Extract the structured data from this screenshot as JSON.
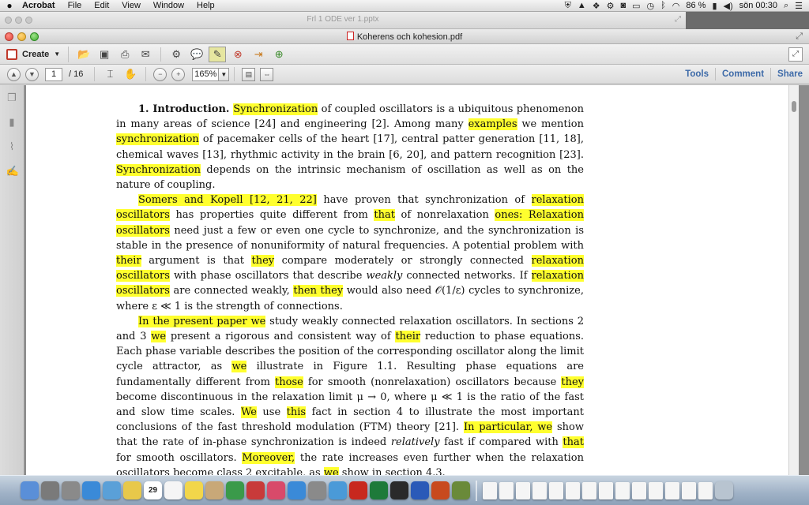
{
  "menubar": {
    "apple": "",
    "items": [
      "Acrobat",
      "File",
      "Edit",
      "View",
      "Window",
      "Help"
    ],
    "battery": "86 %",
    "clock": "sön 00:30"
  },
  "background_window": {
    "title": "Frl 1 ODE ver 1.pptx"
  },
  "window": {
    "title": "Koherens och kohesion.pdf"
  },
  "toolbar": {
    "create_label": "Create"
  },
  "navigation": {
    "current_page": "1",
    "total_pages": "/ 16",
    "zoom": "165%"
  },
  "panels": {
    "tools": "Tools",
    "comment": "Comment",
    "share": "Share"
  },
  "document": {
    "paragraphs": [
      [
        {
          "t": "1. Introduction. ",
          "b": true
        },
        {
          "t": "Synchronization",
          "hl": true
        },
        {
          "t": " of coupled oscillators is a ubiquitous phe­nomenon in many areas of science [24] and engineering [2]. Among many "
        },
        {
          "t": "examples",
          "hl": true
        },
        {
          "t": " we mention "
        },
        {
          "t": "synchronization",
          "hl": true
        },
        {
          "t": " of pacemaker cells of the heart [17], central patter gener­ation [11, 18], chemical waves [13], rhythmic activity in the brain [6, 20], and pattern recognition [23]. "
        },
        {
          "t": "Synchronization",
          "hl": true
        },
        {
          "t": " depends on the intrinsic mechanism of oscillation as well as on the nature of coupling."
        }
      ],
      [
        {
          "t": "Somers and Kopell [12, 21, 22]",
          "hl": true
        },
        {
          "t": " have proven that synchronization of "
        },
        {
          "t": "relaxation oscillators",
          "hl": true
        },
        {
          "t": " has properties quite different from "
        },
        {
          "t": "that",
          "hl": true
        },
        {
          "t": " of nonrelaxation "
        },
        {
          "t": "ones: Relaxation oscillators",
          "hl": true
        },
        {
          "t": " need just a few or even one cycle to synchronize, and the synchronization is stable in the presence of nonuniformity of natural frequencies. A potential problem with "
        },
        {
          "t": "their",
          "hl": true
        },
        {
          "t": " argument is that "
        },
        {
          "t": "they",
          "hl": true
        },
        {
          "t": " compare moderately or strongly connected "
        },
        {
          "t": "relax­ation oscillators",
          "hl": true
        },
        {
          "t": " with phase oscillators that describe "
        },
        {
          "t": "weakly",
          "i": true
        },
        {
          "t": " connected networks. If "
        },
        {
          "t": "relaxation oscillators",
          "hl": true
        },
        {
          "t": " are connected weakly, "
        },
        {
          "t": "then they",
          "hl": true
        },
        {
          "t": " would also need 𝒪(1/ε) cycles to synchronize, where ε ≪ 1 is the strength of connections."
        }
      ],
      [
        {
          "t": "In the present paper we",
          "hl": true
        },
        {
          "t": " study weakly connected relaxation oscillators. In sections 2 and 3 "
        },
        {
          "t": "we",
          "hl": true
        },
        {
          "t": " present a rigorous and consistent way of "
        },
        {
          "t": "their",
          "hl": true
        },
        {
          "t": " reduction to phase equations. Each phase variable describes the position of the corresponding oscillator along the limit cycle attractor, as "
        },
        {
          "t": "we",
          "hl": true
        },
        {
          "t": " illustrate in Figure 1.1. Resulting phase equations are fundamentally different from "
        },
        {
          "t": "those",
          "hl": true
        },
        {
          "t": " for smooth (nonrelaxation) oscillators because "
        },
        {
          "t": "they",
          "hl": true
        },
        {
          "t": " become discontinuous in the relaxation limit μ → 0, where μ ≪ 1 is the ratio of the fast and slow time scales. "
        },
        {
          "t": "We",
          "hl": true
        },
        {
          "t": " use "
        },
        {
          "t": "this",
          "hl": true
        },
        {
          "t": " fact in section 4 to illustrate the most important conclusions of the fast threshold modulation (FTM) theory [21]. "
        },
        {
          "t": "In particular, we",
          "hl": true
        },
        {
          "t": " show that the rate of in-phase synchronization is indeed "
        },
        {
          "t": "relatively",
          "i": true
        },
        {
          "t": " fast if compared with "
        },
        {
          "t": "that",
          "hl": true
        },
        {
          "t": " for smooth oscillators. "
        },
        {
          "t": "Moreover,",
          "hl": true
        },
        {
          "t": " the rate increases even further when the relaxation oscillators become class 2 excitable, as "
        },
        {
          "t": "we",
          "hl": true
        },
        {
          "t": " show in section 4.3."
        }
      ]
    ]
  },
  "dock": {
    "calendar_day": "29",
    "apps": [
      "finder-icon",
      "launchpad-icon",
      "system-prefs-icon",
      "safari-icon",
      "preview-icon",
      "notes-icon",
      "calendar-icon",
      "reminders-icon",
      "stickies-icon",
      "contacts-icon",
      "facetime-icon",
      "photobooth-icon",
      "itunes-icon",
      "appstore-icon",
      "systemprefs2-icon",
      "photos-icon",
      "acrobat-icon",
      "excel-icon",
      "activity-monitor-icon",
      "word-icon",
      "powerpoint-icon",
      "misc-app-icon"
    ]
  }
}
